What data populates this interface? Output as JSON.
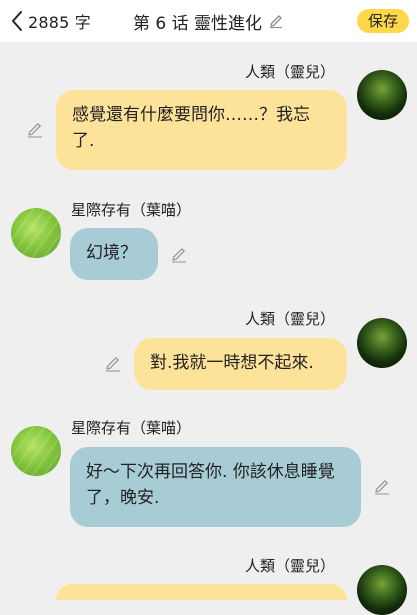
{
  "header": {
    "word_count": "2885 字",
    "title": "第 6 话 靈性進化",
    "save_label": "保存"
  },
  "messages": [
    {
      "sender": "人類（靈兒）",
      "text": "感覺還有什麼要問你……？我忘了."
    },
    {
      "sender": "星際存有（葉喵）",
      "text": "幻境？"
    },
    {
      "sender": "人類（靈兒）",
      "text": "對.我就一時想不起來."
    },
    {
      "sender": "星際存有（葉喵）",
      "text": "好～下次再回答你. 你該休息睡覺了，晚安."
    },
    {
      "sender": "人類（靈兒）",
      "text": ""
    }
  ],
  "icons": {
    "back": "chevron-left-icon",
    "title_edit": "pencil-icon",
    "message_edit": "pencil-icon"
  },
  "colors": {
    "background": "#efefef",
    "header": "#ffffff",
    "save_button": "#ffd84a",
    "human_bubble": "#fde39a",
    "being_bubble": "#a8ccd6"
  }
}
